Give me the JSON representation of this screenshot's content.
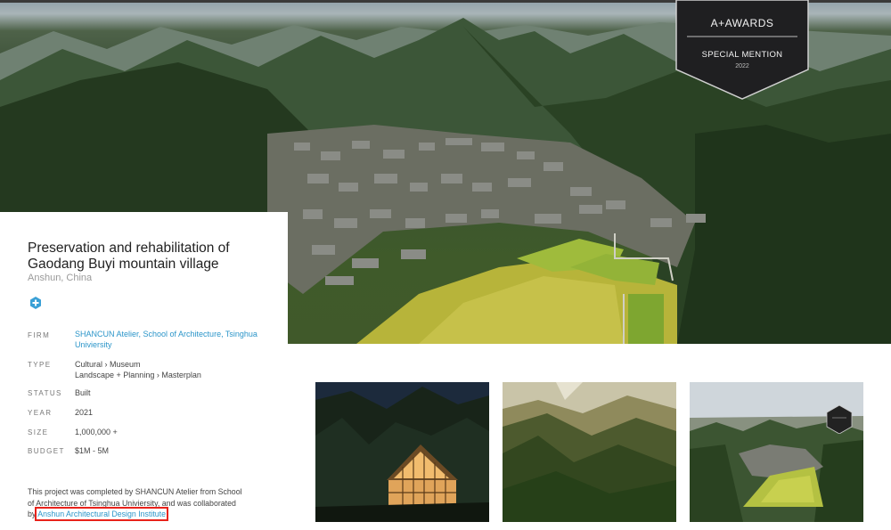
{
  "award": {
    "name": "A+AWARDS",
    "category": "SPECIAL MENTION",
    "year": "2022"
  },
  "project": {
    "title": "Preservation and rehabilitation of Gaodang Buyi mountain village",
    "location": "Anshun, China",
    "details": {
      "firm_label": "FIRM",
      "firm_value": "SHANCUN Atelier, School of Architecture, Tsinghua Univiersity",
      "type_label": "TYPE",
      "type_value_1": "Cultural › Museum",
      "type_value_2": "Landscape + Planning › Masterplan",
      "status_label": "STATUS",
      "status_value": "Built",
      "year_label": "YEAR",
      "year_value": "2021",
      "size_label": "SIZE",
      "size_value": "1,000,000 +",
      "budget_label": "BUDGET",
      "budget_value": "$1M - 5M"
    },
    "description_prefix": "This project was completed by SHANCUN Atelier from School of Architecture of Tsinghua Univiersity, and was collaborated by ",
    "description_highlight": "Anshun Architectural Design Institute"
  },
  "icons": [
    "plus-icon",
    "award-badge-icon"
  ],
  "colors": {
    "link": "#2b95c9",
    "highlight_box": "#e8221b",
    "badge_bg": "#1f1f21"
  }
}
